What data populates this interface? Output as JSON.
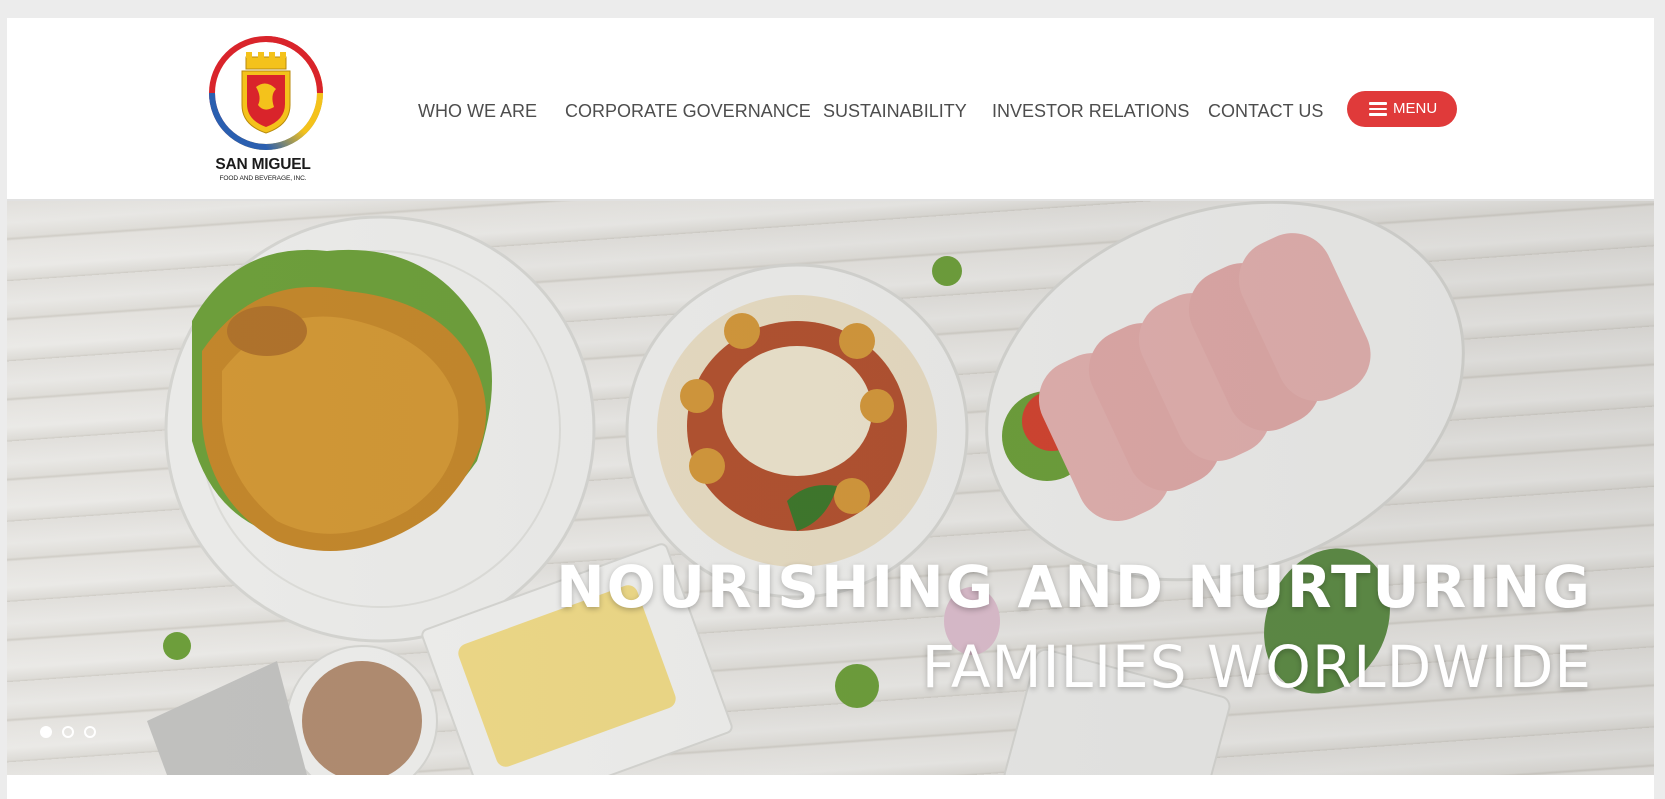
{
  "brand": {
    "name": "SAN MIGUEL",
    "subname": "FOOD AND BEVERAGE, INC.",
    "colors": {
      "accent": "#e03a3a",
      "logo_red": "#d9242b",
      "logo_yellow": "#f4c21b",
      "logo_blue": "#2a5fb0"
    }
  },
  "nav": {
    "items": [
      {
        "label": "WHO WE ARE"
      },
      {
        "label": "CORPORATE GOVERNANCE"
      },
      {
        "label": "SUSTAINABILITY"
      },
      {
        "label": "INVESTOR RELATIONS"
      },
      {
        "label": "CONTACT US"
      }
    ],
    "menu_button": {
      "label": "MENU",
      "icon": "hamburger-icon"
    }
  },
  "hero": {
    "headline_line1": "NOURISHING AND NURTURING",
    "headline_line2": "FAMILIES WORLDWIDE",
    "slides": {
      "count": 3,
      "active": 1
    }
  }
}
